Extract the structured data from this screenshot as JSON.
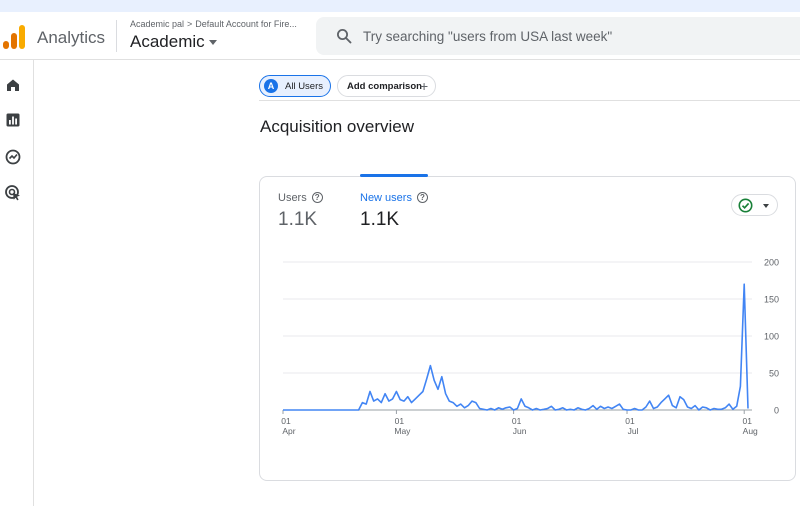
{
  "header": {
    "app_title": "Analytics",
    "breadcrumb": {
      "account": "Academic pal",
      "separator": ">",
      "property_path": "Default Account for Fire..."
    },
    "property_name": "Academic",
    "search": {
      "placeholder": "Try searching \"users from USA last week\""
    }
  },
  "nav": {
    "items": [
      {
        "icon": "home-icon",
        "label": "Home"
      },
      {
        "icon": "reports-icon",
        "label": "Reports"
      },
      {
        "icon": "explore-icon",
        "label": "Explore"
      },
      {
        "icon": "advertising-icon",
        "label": "Advertising"
      }
    ]
  },
  "comparison": {
    "all_users_badge": "A",
    "all_users_label": "All Users",
    "add_comparison_label": "Add comparison",
    "add_icon": "+"
  },
  "page": {
    "title": "Acquisition overview"
  },
  "card": {
    "metrics": [
      {
        "label": "Users",
        "value": "1.1K",
        "active": false
      },
      {
        "label": "New users",
        "value": "1.1K",
        "active": true
      }
    ],
    "status_icon": "check-circle-icon"
  },
  "colors": {
    "accent": "#1a73e8",
    "line": "#4285f4",
    "status_green": "#188038"
  },
  "chart_data": {
    "type": "line",
    "title": "",
    "xlabel": "",
    "ylabel": "",
    "x_ticks": [
      {
        "day": "01",
        "month": "Apr",
        "index": 0
      },
      {
        "day": "01",
        "month": "May",
        "index": 30
      },
      {
        "day": "01",
        "month": "Jun",
        "index": 61
      },
      {
        "day": "01",
        "month": "Jul",
        "index": 91
      },
      {
        "day": "01",
        "month": "Aug",
        "index": 122
      }
    ],
    "y_ticks": [
      0,
      50,
      100,
      150,
      200
    ],
    "ylim": [
      0,
      200
    ],
    "y_axis_side": "right",
    "grid": true,
    "series": [
      {
        "values": [
          0,
          0,
          0,
          0,
          0,
          0,
          0,
          0,
          0,
          0,
          0,
          0,
          0,
          0,
          0,
          0,
          0,
          0,
          0,
          0,
          0,
          10,
          8,
          25,
          12,
          15,
          10,
          22,
          12,
          15,
          25,
          14,
          12,
          18,
          10,
          15,
          20,
          25,
          42,
          60,
          40,
          28,
          45,
          22,
          12,
          10,
          5,
          8,
          3,
          6,
          12,
          10,
          2,
          1,
          0,
          2,
          0,
          3,
          1,
          3,
          4,
          0,
          2,
          15,
          5,
          3,
          0,
          2,
          0,
          1,
          2,
          5,
          0,
          1,
          3,
          0,
          1,
          0,
          3,
          1,
          0,
          2,
          6,
          1,
          5,
          2,
          4,
          2,
          5,
          8,
          1,
          0,
          0,
          2,
          0,
          0,
          4,
          12,
          2,
          4,
          10,
          15,
          20,
          6,
          3,
          18,
          14,
          4,
          2,
          6,
          0,
          4,
          3,
          0,
          2,
          1,
          1,
          3,
          8,
          1,
          5,
          32,
          170,
          2
        ]
      }
    ]
  }
}
